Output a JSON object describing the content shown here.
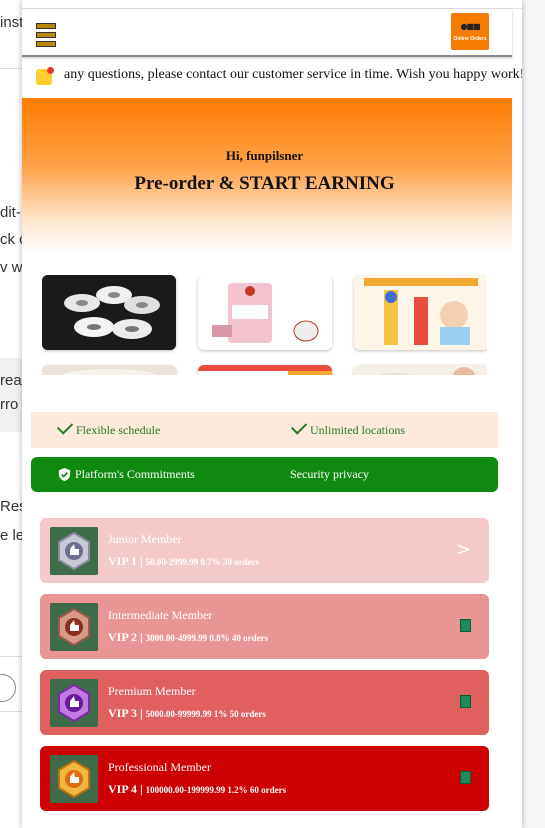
{
  "background": {
    "fragments": [
      "inst",
      "dit-",
      "ck c",
      "v w",
      "rea",
      "rro",
      "Res",
      "e le"
    ]
  },
  "header": {
    "menu_icon": "hamburger-menu-icon",
    "logo_icon": "cart-logo-icon",
    "logo_text": "Online Orders"
  },
  "notice": {
    "icon": "bell-icon",
    "text": "any questions, please contact our customer service in time. Wish you happy work!"
  },
  "hero": {
    "greeting": "Hi, funpilsner",
    "title": "Pre-order & START EARNING"
  },
  "features": [
    {
      "label": "Flexible schedule",
      "icon": "check-icon"
    },
    {
      "label": "Unlimited locations",
      "icon": "check-icon"
    }
  ],
  "commitments": {
    "icon": "shield-check-icon",
    "label": "Platform's Commitments",
    "security_label": "Security privacy",
    "color": "#0f8a0f"
  },
  "vip_levels": [
    {
      "name": "Junior Member",
      "level": "VIP 1",
      "details": "50.00-2999.99 0.7% 30 orders",
      "color": "#f4c9c9",
      "indicator": ">"
    },
    {
      "name": "Intermediate Member",
      "level": "VIP 2",
      "details": "3000.00-4999.99 0.8% 40 orders",
      "color": "#ea9595",
      "indicator": ""
    },
    {
      "name": "Premium Member",
      "level": "VIP 3",
      "details": "5000.00-99999.99 1% 50 orders",
      "color": "#e06060",
      "indicator": ""
    },
    {
      "name": "Professional Member",
      "level": "VIP 4",
      "details": "100000.00-199999.99 1.2% 60 orders",
      "color": "#cc0000",
      "indicator": ""
    }
  ],
  "separator": "|",
  "colors": {
    "hero_orange": "#ff7d00",
    "feature_bg": "#fdeadc",
    "feature_text": "#1f7a1f"
  }
}
